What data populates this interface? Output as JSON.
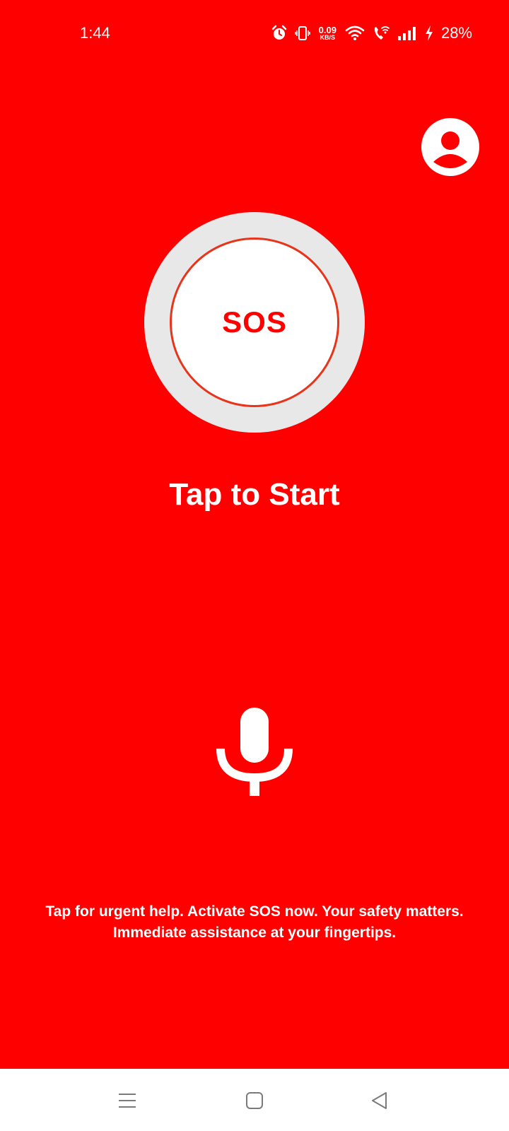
{
  "status_bar": {
    "time": "1:44",
    "net_speed_value": "0.09",
    "net_speed_unit": "KB/S",
    "battery": "28%",
    "icons": [
      "alarm-icon",
      "vibrate-icon",
      "wifi-icon",
      "wifi-calling-icon",
      "signal-icon",
      "charging-icon"
    ]
  },
  "main": {
    "profile_icon": "account-circle-icon",
    "sos_label": "SOS",
    "tap_to_start": "Tap to Start",
    "mic_icon": "microphone-icon",
    "footer_line1": "Tap for urgent help. Activate SOS now. Your safety matters.",
    "footer_line2": "Immediate assistance at your fingertips."
  },
  "nav_bar": {
    "buttons": [
      "menu-icon",
      "home-icon",
      "back-icon"
    ]
  },
  "colors": {
    "background": "#ff0000",
    "sos_ring": "#e8e8e8",
    "sos_border": "#e8341a",
    "text": "#ffffff",
    "nav_icon": "#7a7a7a"
  }
}
